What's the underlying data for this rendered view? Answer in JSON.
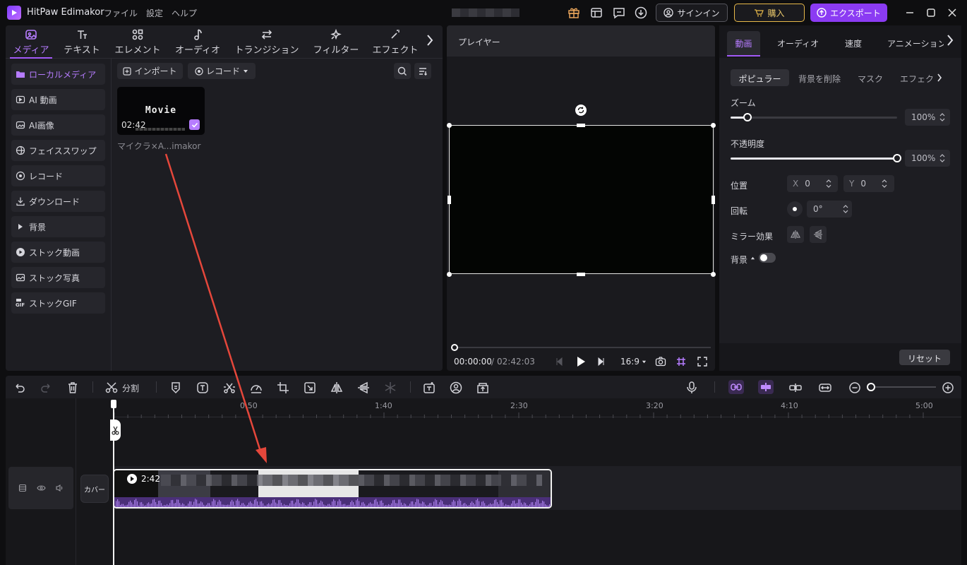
{
  "app": {
    "title": "HitPaw Edimakor",
    "menu": [
      "ファイル",
      "設定",
      "ヘルプ"
    ],
    "signin": "サインイン",
    "buy": "購入",
    "export": "エクスポート"
  },
  "categories": [
    {
      "label": "メディア",
      "icon": "media-icon",
      "active": true
    },
    {
      "label": "テキスト",
      "icon": "text-icon"
    },
    {
      "label": "エレメント",
      "icon": "element-icon"
    },
    {
      "label": "オーディオ",
      "icon": "music-note-icon"
    },
    {
      "label": "トランジション",
      "icon": "transition-icon"
    },
    {
      "label": "フィルター",
      "icon": "filter-icon"
    },
    {
      "label": "エフェクト",
      "icon": "effect-icon"
    }
  ],
  "sidebar": {
    "items": [
      {
        "label": "ローカルメディア",
        "active": true
      },
      {
        "label": "AI 動画"
      },
      {
        "label": "AI画像"
      },
      {
        "label": "フェイススワップ"
      },
      {
        "label": "レコード"
      },
      {
        "label": "ダウンロード"
      },
      {
        "label": "背景"
      },
      {
        "label": "ストック動画"
      },
      {
        "label": "ストック写真"
      },
      {
        "label": "ストックGIF"
      }
    ]
  },
  "media": {
    "import_label": "インポート",
    "record_label": "レコード",
    "thumb_title": "Movie",
    "thumb_duration": "02:42",
    "item_name": "マイクラ×A...imakor"
  },
  "player": {
    "title": "プレイヤー",
    "current_time": "00:00:00",
    "separator": "/",
    "total_time": "02:42:03",
    "ratio": "16:9"
  },
  "props": {
    "tabs": [
      "動画",
      "オーディオ",
      "速度",
      "アニメーション"
    ],
    "subtabs": [
      "ポピュラー",
      "背景を削除",
      "マスク",
      "エフェク"
    ],
    "zoom_label": "ズーム",
    "zoom_value": "100%",
    "zoom_level": 0.1,
    "opacity_label": "不透明度",
    "opacity_value": "100%",
    "opacity_level": 1.0,
    "position_label": "位置",
    "x_label": "X",
    "x_value": "0",
    "y_label": "Y",
    "y_value": "0",
    "rotate_label": "回転",
    "rotate_value": "0°",
    "mirror_label": "ミラー効果",
    "background_label": "背景",
    "reset_label": "リセット"
  },
  "toolbar": {
    "split_label": "分割"
  },
  "timeline": {
    "ruler": [
      "0:50",
      "1:40",
      "2:30",
      "3:20",
      "4:10",
      "5:00"
    ],
    "cover_label": "カバー",
    "clip_duration": "2:42"
  },
  "colors": {
    "accent": "#a259f7",
    "export_bg": "#8b3bf3",
    "buy_border": "#e8b94a",
    "arrow": "#e5473b"
  }
}
